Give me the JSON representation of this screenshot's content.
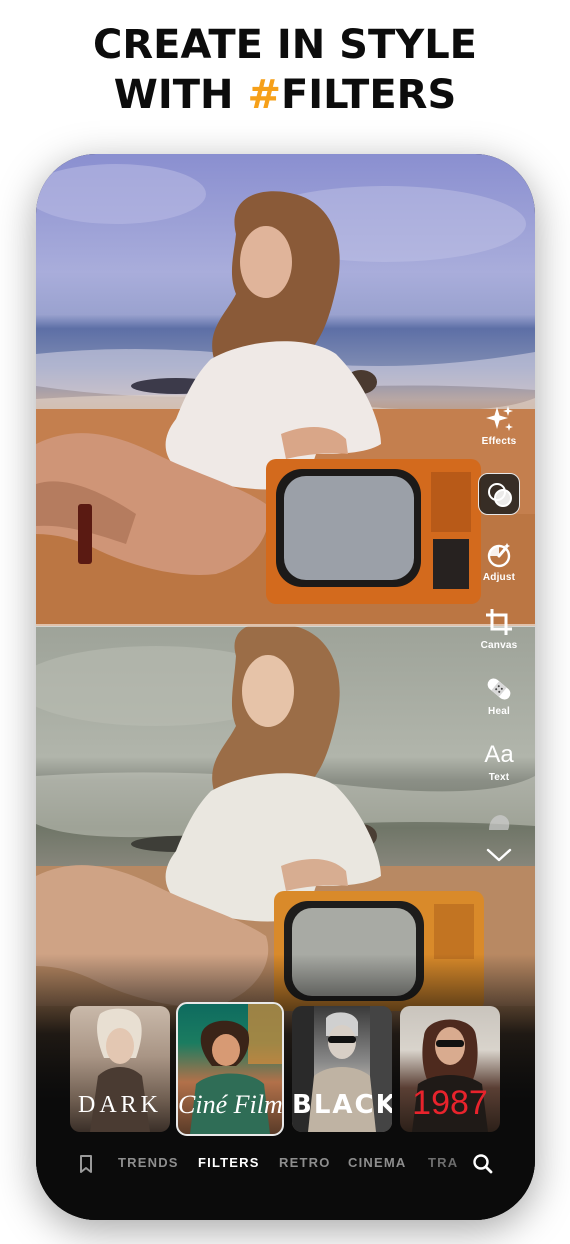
{
  "promo": {
    "line1": "CREATE IN STYLE",
    "line2_prefix": "WITH ",
    "line2_accent": "#",
    "line2_suffix": "FILTERS",
    "accent_color": "#f6a019"
  },
  "toolbar": {
    "effects": {
      "label": "Effects",
      "icon": "sparkles-icon"
    },
    "filters": {
      "label": "",
      "icon": "filter-circles-icon",
      "selected": true
    },
    "adjust": {
      "label": "Adjust",
      "icon": "adjust-dial-icon"
    },
    "canvas": {
      "label": "Canvas",
      "icon": "crop-icon"
    },
    "heal": {
      "label": "Heal",
      "icon": "bandage-icon"
    },
    "text": {
      "label": "Text",
      "glyph": "Aa",
      "icon": "text-icon"
    },
    "more": {
      "icon": "shape-icon"
    },
    "expand": {
      "icon": "chevron-down-icon"
    }
  },
  "filters": [
    {
      "name": "DARK",
      "selected": false
    },
    {
      "name": "Ciné Film",
      "selected": true
    },
    {
      "name": "BLACK",
      "selected": false
    },
    {
      "name": "1987",
      "selected": false
    }
  ],
  "tabs": {
    "bookmark_icon": "bookmark-icon",
    "items": [
      "TRENDS",
      "FILTERS",
      "RETRO",
      "CINEMA",
      "TRA"
    ],
    "active": "FILTERS",
    "search_icon": "search-icon"
  }
}
